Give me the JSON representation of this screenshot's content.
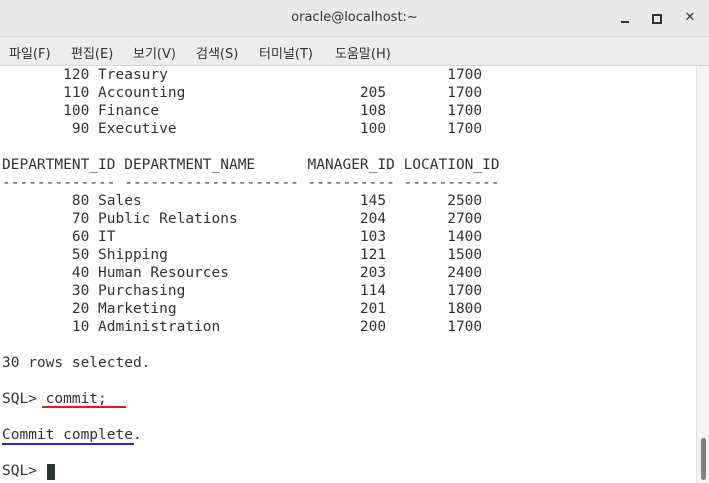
{
  "window": {
    "title": "oracle@localhost:~",
    "minimize_glyph": "",
    "maximize_glyph": "",
    "close_glyph": "✕"
  },
  "menubar": {
    "items": [
      {
        "label": "파일(F)"
      },
      {
        "label": "편집(E)"
      },
      {
        "label": "보기(V)"
      },
      {
        "label": "검색(S)"
      },
      {
        "label": "터미널(T)"
      },
      {
        "label": "도움말(H)"
      }
    ]
  },
  "terminal": {
    "lines": [
      "       120 Treasury                                1700",
      "       110 Accounting                    205       1700",
      "       100 Finance                       108       1700",
      "        90 Executive                     100       1700",
      "",
      "DEPARTMENT_ID DEPARTMENT_NAME      MANAGER_ID LOCATION_ID",
      "------------- -------------------- ---------- -----------",
      "        80 Sales                         145       2500",
      "        70 Public Relations              204       2700",
      "        60 IT                            103       1400",
      "        50 Shipping                      121       1500",
      "        40 Human Resources               203       2400",
      "        30 Purchasing                    114       1700",
      "        20 Marketing                     201       1800",
      "        10 Administration                200       1700",
      "",
      "30 rows selected.",
      "",
      "SQL> commit;",
      "",
      "Commit complete.",
      "",
      "SQL> "
    ]
  },
  "colors": {
    "commit_underline": "#e01b1b",
    "complete_underline": "#1c2fc9",
    "text": "#2e3436"
  },
  "icons": {
    "minimize": "minimize-icon",
    "maximize": "maximize-icon",
    "close": "close-icon"
  }
}
